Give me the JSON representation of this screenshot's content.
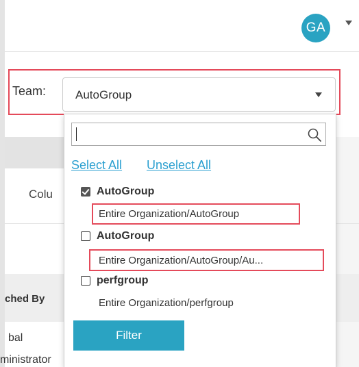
{
  "header": {
    "avatar_initials": "GA"
  },
  "background": {
    "column_fragment": "Colu",
    "table_header_fragment": "ched By",
    "row_line1_fragment": "bal",
    "row_line2_fragment": "ministrator"
  },
  "team_filter": {
    "label": "Team:",
    "selected_value": "AutoGroup",
    "search": {
      "value": "",
      "placeholder": ""
    },
    "select_all_label": "Select All",
    "unselect_all_label": "Unselect All",
    "options": [
      {
        "name": "AutoGroup",
        "path": "Entire Organization/AutoGroup",
        "checked": true
      },
      {
        "name": "AutoGroup",
        "path": "Entire Organization/AutoGroup/Au...",
        "checked": false
      },
      {
        "name": "perfgroup",
        "path": "Entire Organization/perfgroup",
        "checked": false
      }
    ],
    "filter_button_label": "Filter"
  },
  "colors": {
    "accent": "#2aa3c2",
    "link": "#2a9fd0",
    "highlight": "#e44a5a"
  }
}
